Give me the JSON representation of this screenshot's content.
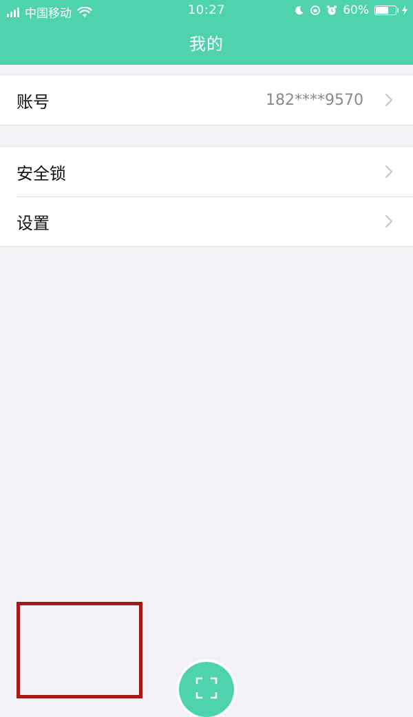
{
  "status_bar": {
    "carrier": "中国移动",
    "time": "10:27",
    "battery_percent": "60%"
  },
  "header": {
    "title": "我的"
  },
  "account_section": {
    "label": "账号",
    "value": "182****9570"
  },
  "settings_section": {
    "items": [
      {
        "label": "安全锁"
      },
      {
        "label": "设置"
      }
    ]
  },
  "colors": {
    "accent": "#4fd3ae",
    "annotation_red": "#a71813",
    "background": "#f2f1f6"
  }
}
